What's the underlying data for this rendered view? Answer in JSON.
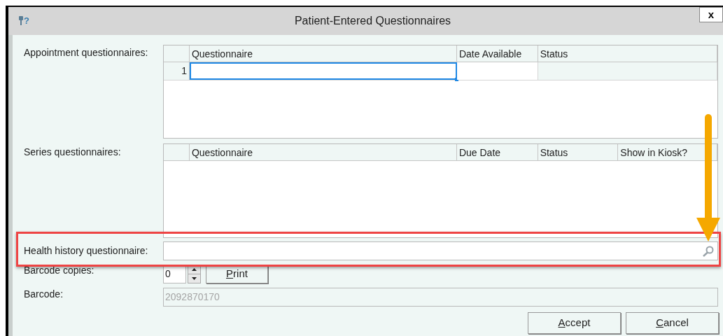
{
  "window": {
    "title": "Patient-Entered Questionnaires",
    "help_glyph": "?",
    "close": "x"
  },
  "appointment_questionnaires": {
    "label": "Appointment questionnaires:",
    "columns": [
      {
        "name": "Questionnaire",
        "read_only": false
      },
      {
        "name": "Date Available",
        "read_only": false
      },
      {
        "name": "Status",
        "read_only": true
      }
    ],
    "rows": [
      {
        "number": "1",
        "selected": true
      }
    ]
  },
  "series_questionnaires": {
    "label": "Series questionnaires:",
    "columns": [
      {
        "name": "Questionnaire"
      },
      {
        "name": "Due Date"
      },
      {
        "name": "Status"
      },
      {
        "name": "Show in Kiosk?"
      }
    ]
  },
  "health_history": {
    "label": "Health history questionnaire:"
  },
  "barcode_copies": {
    "label": "Barcode copies:",
    "value": "0",
    "print_button": {
      "access_key": "P",
      "label_rest": "rint"
    }
  },
  "barcode": {
    "label": "Barcode:",
    "value": "2092870170",
    "disabled": true
  },
  "buttons": [
    {
      "access_key": "A",
      "label_rest": "ccept"
    },
    {
      "access_key": "C",
      "label_rest": "ancel"
    }
  ]
}
